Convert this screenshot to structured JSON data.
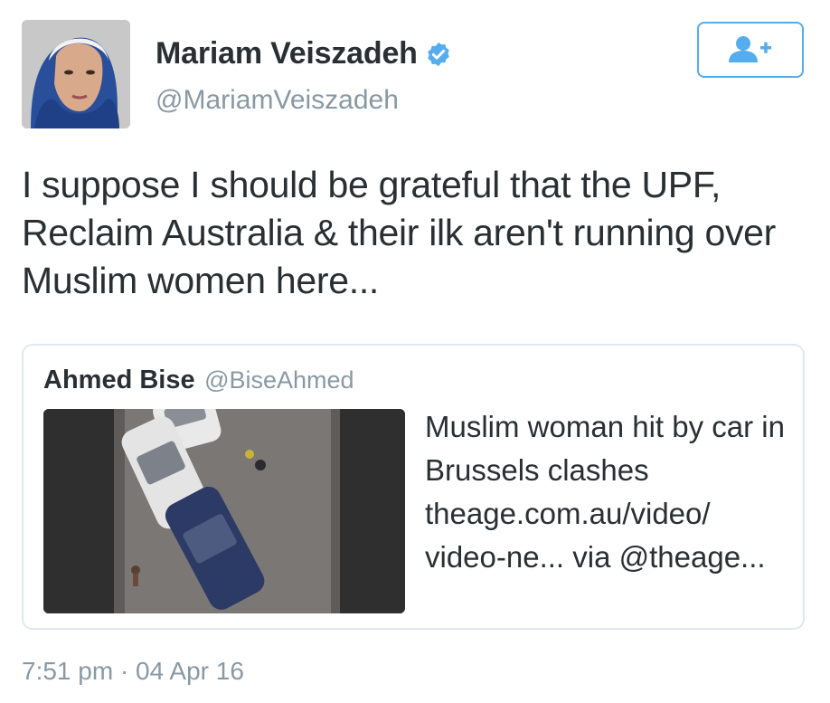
{
  "author": {
    "display_name": "Mariam Veiszadeh",
    "handle": "@MariamVeiszadeh",
    "verified": true,
    "avatar_icon": "profile-photo"
  },
  "follow_button": {
    "icon": "add-user-icon",
    "color": "#55acee"
  },
  "tweet": {
    "text": "I suppose I should be grateful that the UPF, Reclaim Australia & their ilk aren't running over Muslim women here..."
  },
  "quoted_tweet": {
    "display_name": "Ahmed Bise",
    "handle": "@BiseAhmed",
    "text": "Muslim woman hit by car in Brussels clashes theage.com.au/video/ video-ne... via @theage..."
  },
  "timestamp": "7:51 pm · 04 Apr 16",
  "colors": {
    "accent": "#55acee",
    "muted": "#8899a6",
    "text": "#292f33",
    "border": "#e1e8ed"
  }
}
